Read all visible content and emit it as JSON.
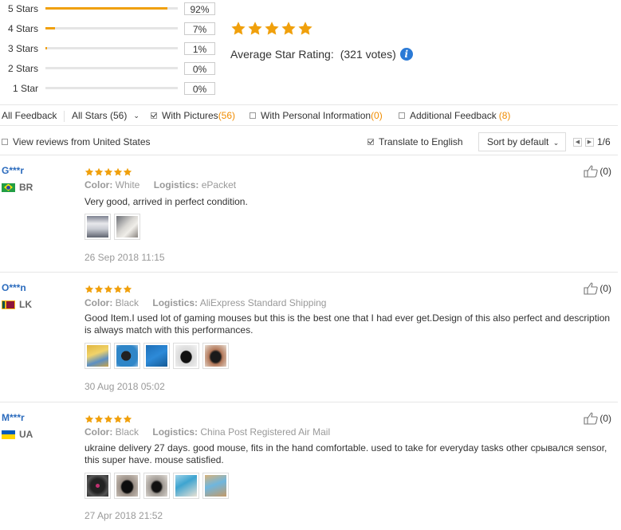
{
  "rating_breakdown": [
    {
      "label": "5 Stars",
      "percent_text": "92%",
      "fill": 0.92
    },
    {
      "label": "4 Stars",
      "percent_text": "7%",
      "fill": 0.07
    },
    {
      "label": "3 Stars",
      "percent_text": "1%",
      "fill": 0.01
    },
    {
      "label": "2 Stars",
      "percent_text": "0%",
      "fill": 0
    },
    {
      "label": "1 Star",
      "percent_text": "0%",
      "fill": 0
    }
  ],
  "summary": {
    "stars": 5,
    "label": "Average Star Rating:",
    "votes": "(321 votes)",
    "info_icon": "info-icon",
    "star_color": "#f0a00c"
  },
  "filters": {
    "all_feedback": "All Feedback",
    "all_stars": "All Stars (56)",
    "with_pictures": "With Pictures",
    "with_pictures_count": "(56)",
    "with_pictures_checked": true,
    "personal_info": "With Personal Information",
    "personal_info_count": "(0)",
    "personal_info_checked": false,
    "additional_feedback": "Additional Feedback",
    "additional_feedback_count": "(8)",
    "additional_feedback_checked": false
  },
  "options": {
    "view_us": "View reviews from United States",
    "view_us_checked": false,
    "translate": "Translate to English",
    "translate_checked": true,
    "sort_label": "Sort by default",
    "page": "1/6"
  },
  "reviews": [
    {
      "name": "G***r",
      "country": "BR",
      "stars": 5,
      "color_label": "Color:",
      "color": "White",
      "logistics_label": "Logistics:",
      "logistics": "ePacket",
      "text": "Very good, arrived in perfect condition.",
      "photo_count": 2,
      "date": "26 Sep 2018 11:15",
      "helpful": "(0)"
    },
    {
      "name": "O***n",
      "country": "LK",
      "stars": 5,
      "color_label": "Color:",
      "color": "Black",
      "logistics_label": "Logistics:",
      "logistics": "AliExpress Standard Shipping",
      "text": "Good Item.I used lot of gaming mouses but this is the best one that I had ever get.Design of this also perfect and description is always match with this performances.",
      "photo_count": 5,
      "date": "30 Aug 2018 05:02",
      "helpful": "(0)"
    },
    {
      "name": "M***r",
      "country": "UA",
      "stars": 5,
      "color_label": "Color:",
      "color": "Black",
      "logistics_label": "Logistics:",
      "logistics": "China Post Registered Air Mail",
      "text": "ukraine delivery 27 days. good mouse, fits in the hand comfortable. used to take for everyday tasks other срывался sensor, this super have. mouse satisfied.",
      "photo_count": 5,
      "date": "27 Apr 2018 21:52",
      "helpful": "(0)"
    }
  ]
}
